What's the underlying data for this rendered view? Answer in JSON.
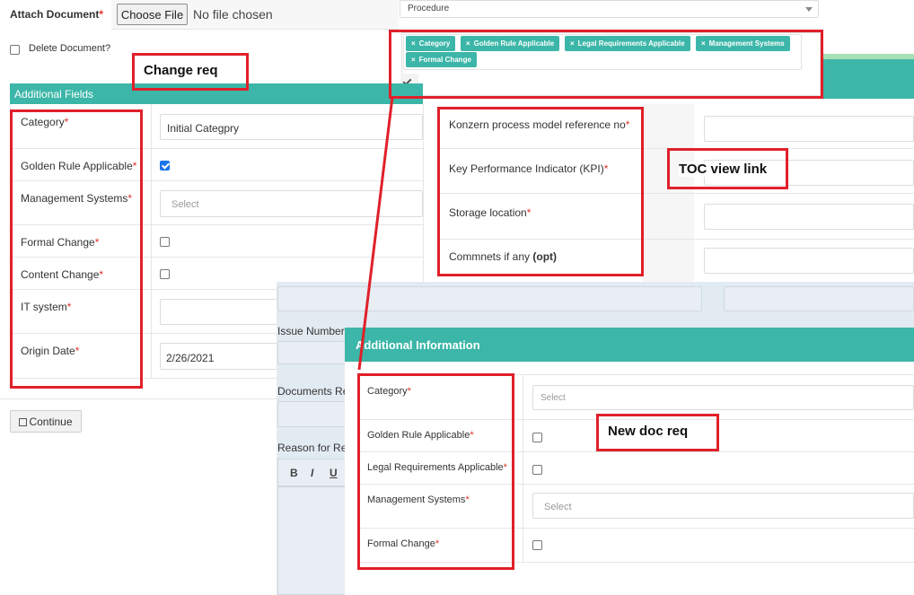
{
  "attach": {
    "label": "Attach Document",
    "required_mark": "*",
    "choose_file_label": "Choose File",
    "file_status": "No file chosen"
  },
  "delete_doc": {
    "label": "Delete Document?",
    "checked": false
  },
  "doc_type": {
    "value": "Procedure"
  },
  "chips": [
    "Category",
    "Golden Rule Applicable",
    "Legal Requirements Applicable",
    "Management Systems",
    "Formal Change"
  ],
  "annotations": {
    "change_req": "Change req",
    "toc_view_link": "TOC view link",
    "new_doc_req": "New doc req"
  },
  "additional_fields": {
    "title": "Additional Fields",
    "rows": [
      {
        "label": "Category",
        "type": "text",
        "value": "Initial Categpry"
      },
      {
        "label": "Golden Rule Applicable",
        "type": "checkbox",
        "checked": true
      },
      {
        "label": "Management Systems",
        "type": "select",
        "placeholder": "Select"
      },
      {
        "label": "Formal Change",
        "type": "checkbox",
        "checked": false
      },
      {
        "label": "Content Change",
        "type": "checkbox",
        "checked": false
      },
      {
        "label": "IT system",
        "type": "text",
        "value": ""
      },
      {
        "label": "Origin Date",
        "type": "text",
        "value": "2/26/2021"
      }
    ]
  },
  "right_fields": {
    "rows": [
      {
        "label": "Konzern process model reference no",
        "required_mark": "*"
      },
      {
        "label": "Key Performance Indicator (KPI)",
        "required_mark": "*"
      },
      {
        "label": "Storage location",
        "required_mark": "*"
      },
      {
        "label": "Commnets if any",
        "opt_mark": "(opt)"
      }
    ]
  },
  "continue_button": {
    "label": "Continue"
  },
  "back_form": {
    "issue_number": "Issue Number",
    "documents_re": "Documents Re",
    "reason_for_re": "Reason for Re",
    "editor_bold": "B",
    "editor_italic": "I",
    "editor_underline": "U"
  },
  "additional_information": {
    "title": "Additional Information",
    "rows": [
      {
        "label": "Category",
        "type": "select",
        "placeholder": "Select"
      },
      {
        "label": "Golden Rule Applicable",
        "type": "checkbox",
        "checked": false
      },
      {
        "label": "Legal Requirements Applicable",
        "type": "checkbox",
        "checked": false
      },
      {
        "label": "Management Systems",
        "type": "select",
        "placeholder": "Select"
      },
      {
        "label": "Formal Change",
        "type": "checkbox",
        "checked": false
      }
    ]
  },
  "colors": {
    "teal": "#3cb6a8",
    "annotation_red": "#e0202a",
    "required": "#e0302a",
    "checkbox_blue": "#1a73e8"
  }
}
